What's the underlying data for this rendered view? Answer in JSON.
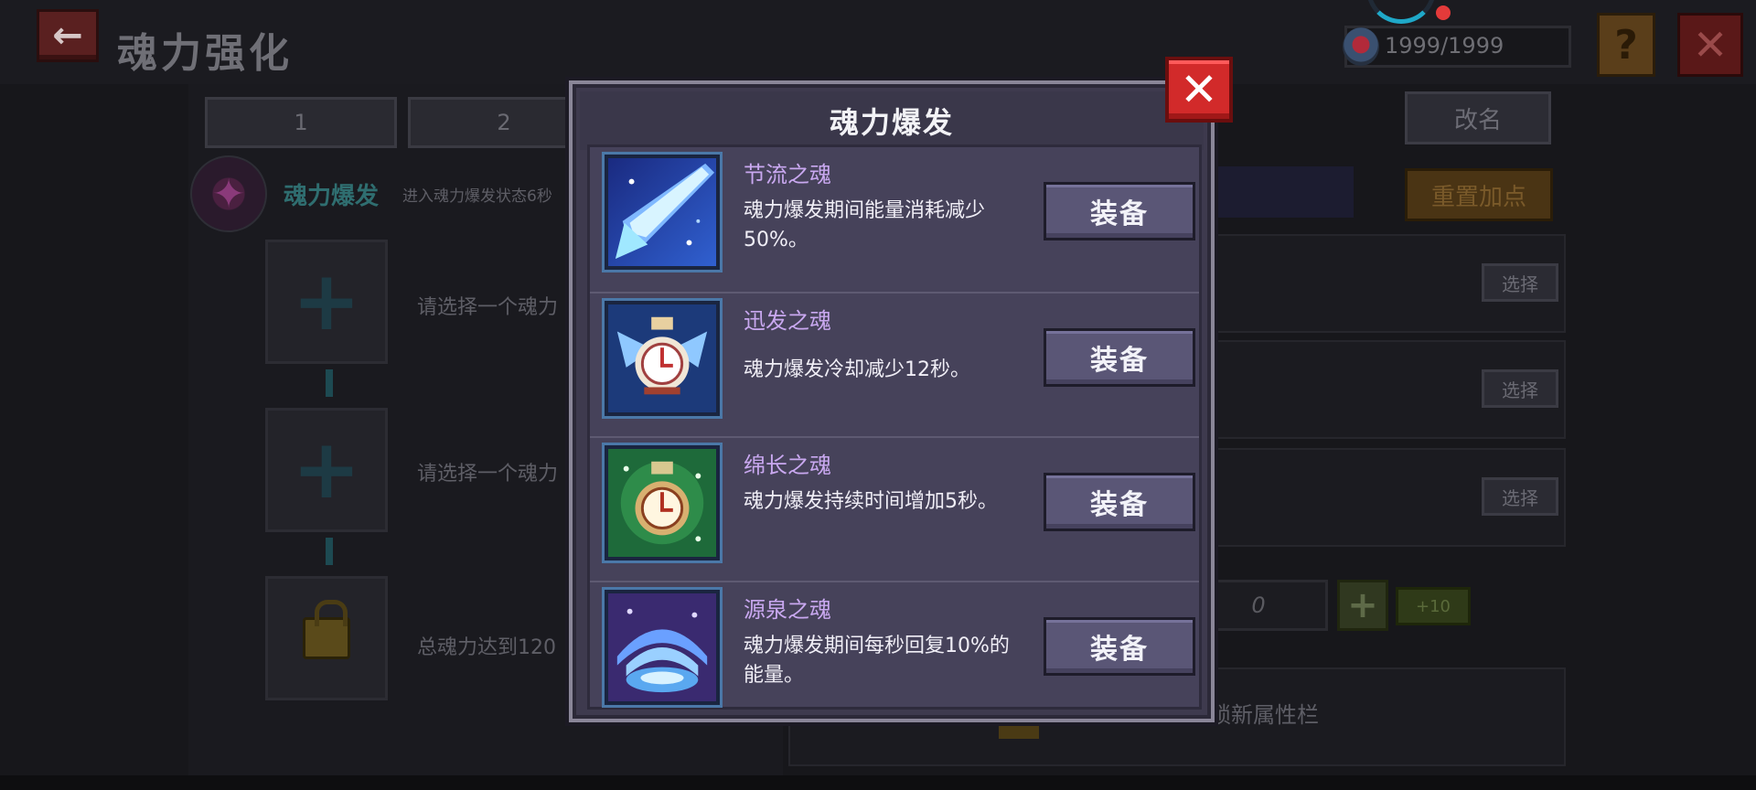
{
  "header": {
    "back_icon": "back-arrow-icon",
    "title": "魂力强化",
    "energy_value": "1999/1999",
    "help_label": "?",
    "close_label": "✕"
  },
  "left": {
    "tabs": [
      {
        "label": "1"
      },
      {
        "label": "2"
      }
    ],
    "burst_label": "魂力爆发",
    "burst_desc": "进入魂力爆发状态6秒",
    "slots": [
      {
        "text": "请选择一个魂力"
      },
      {
        "text": "请选择一个魂力"
      },
      {
        "text": "总魂力达到120"
      }
    ]
  },
  "right": {
    "rename_label": "改名",
    "reset_label": "重置加点",
    "rows": [
      {
        "select_label": "选择"
      },
      {
        "select_label": "选择"
      },
      {
        "select_label": "选择"
      }
    ],
    "value": "0",
    "plus_label": "+",
    "plus10_label": "+10",
    "unlock_text": "锁新属性栏"
  },
  "modal": {
    "title": "魂力爆发",
    "close_label": "✕",
    "items": [
      {
        "name": "节流之魂",
        "desc": "魂力爆发期间能量消耗减少50%。",
        "button": "装备",
        "icon": "throttle-soul-icon"
      },
      {
        "name": "迅发之魂",
        "desc": "魂力爆发冷却减少12秒。",
        "button": "装备",
        "icon": "swift-soul-icon"
      },
      {
        "name": "绵长之魂",
        "desc": "魂力爆发持续时间增加5秒。",
        "button": "装备",
        "icon": "lasting-soul-icon"
      },
      {
        "name": "源泉之魂",
        "desc": "魂力爆发期间每秒回复10%的能量。",
        "button": "装备",
        "icon": "fountain-soul-icon"
      }
    ]
  }
}
